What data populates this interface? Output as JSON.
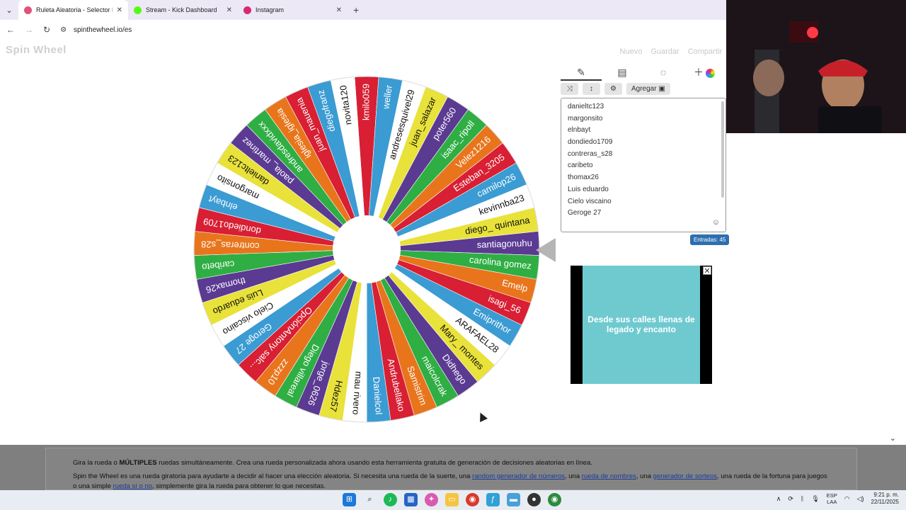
{
  "browser": {
    "tabs": [
      {
        "title": "Ruleta Aleatoria - Selector Personalizado",
        "color": "#e0527a",
        "active": true
      },
      {
        "title": "Stream - Kick Dashboard",
        "color": "#53fc18",
        "active": false
      },
      {
        "title": "Instagram",
        "color": "#d62976",
        "active": false
      }
    ],
    "new_tab": "+",
    "url": "spinthewheel.io/es"
  },
  "site": {
    "logo": "Spin Wheel",
    "menu": [
      "Nuevo",
      "Guardar",
      "Compartir"
    ]
  },
  "wheel": {
    "segment_colors": [
      "#d81f33",
      "#3b9bd3",
      "#ffffff",
      "#e8e23a",
      "#5b3a92",
      "#2fae44",
      "#e8751c"
    ],
    "segments": [
      "kmilo059",
      "weller",
      "andresesquivel29",
      "juan_salazar",
      "poter560",
      "isaac_ripoll",
      "Velez1216",
      "Esteban_3205",
      "camilop26",
      "kevinnba23",
      "diego_ quintana",
      "santiagonuhu",
      "carolina gomez",
      "Emelp",
      "isagi_56",
      "Emiprithor",
      "ARAFAEL28",
      "Mary_ montes",
      "Didhego",
      "maicolcrak",
      "Samistrim",
      "Andrubellako",
      "Danielcol",
      "mau rivero",
      "Hdez57",
      "jorge_0626",
      "Diego villareal",
      "zzzp10",
      "OpciónAntony salc...",
      "Geroge 27",
      "Cielo viscaino",
      "Luis eduardo",
      "thomax26",
      "caribeto",
      "contreras_s28",
      "dondiedo1709",
      "elnbayt",
      "margonsito",
      "danieltc123",
      "paola_ martinez",
      "andresdavidxxx",
      "iglesia_iglesia",
      "juan_mauenia",
      "diegofranz",
      "novita120"
    ]
  },
  "tools": {
    "tabs": [
      "pencil-icon",
      "clipboard-icon",
      "eye-off-icon",
      "add-color-icon"
    ],
    "buttons": [
      "⤨",
      "↕",
      "⚙",
      "Agregar ▣"
    ]
  },
  "entries": [
    "danieltc123",
    "margonsito",
    "elnbayt",
    "dondiedo1709",
    "contreras_s28",
    "caribeto",
    "thomax26",
    "Luis eduardo",
    "Cielo viscaino",
    "Geroge 27"
  ],
  "entries_count": "Entradas: 45",
  "ad": {
    "text": "Desde sus calles llenas de legado y encanto",
    "close": "✕"
  },
  "description": {
    "line1_a": "Gira la rueda o ",
    "line1_b": "MÚLTIPLES",
    "line1_c": " ruedas simultáneamente. Crea una rueda personalizada ahora usando esta herramienta gratuita de generación de decisiones aleatorias en línea.",
    "line2_a": "Spin the Wheel es una rueda giratoria para ayudarte a decidir al hacer una elección aleatoria. Si necesita una rueda de la suerte, una ",
    "link1": "random generador de números",
    "line2_b": ", una ",
    "link2": "rueda de nombres",
    "line2_c": ", una ",
    "link3": "generador de sorteos",
    "line2_d": ", una rueda de la fortuna para juegos o una simple ",
    "link4": "rueda sí o no",
    "line2_e": ", simplemente gira la rueda para obtener lo que necesitas."
  },
  "taskbar": {
    "lang": "ESP",
    "layout": "LAA",
    "time": "9:21 p. m.",
    "date": "22/11/2025"
  }
}
